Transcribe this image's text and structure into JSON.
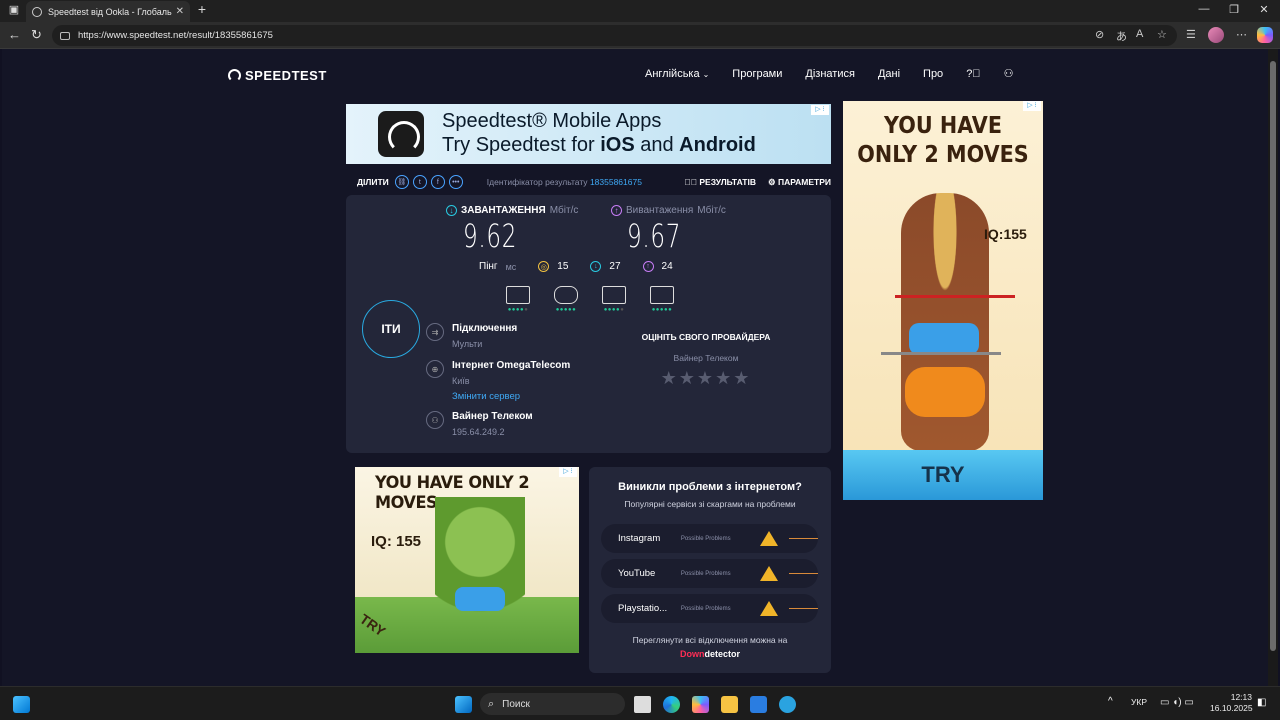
{
  "browser": {
    "tab_title": "Speedtest від Ookla - Глобальний тест швидкості",
    "url": "https://www.speedtest.net/result/18355861675"
  },
  "site": {
    "logo": "SPEEDTEST",
    "nav": [
      "Англійська",
      "Програми",
      "Дізнатися",
      "Дані",
      "Про"
    ]
  },
  "ad_top": {
    "line1": "Speedtest® Mobile Apps",
    "line2_pre": "Try Speedtest for ",
    "line2_ios": "iOS",
    "line2_mid": " and ",
    "line2_android": "Android"
  },
  "share": {
    "label": "ДІЛИТИ",
    "result_id_label": "Ідентифікатор результату",
    "result_id": "18355861675",
    "results_btn": "РЕЗУЛЬТАТІВ",
    "settings_btn": "ПАРАМЕТРИ"
  },
  "result": {
    "download_label": "ЗАВАНТАЖЕННЯ",
    "download_unit": "Мбіт/с",
    "download_value": "9.62",
    "upload_label": "Вивантаження",
    "upload_unit": "Мбіт/с",
    "upload_value": "9.67",
    "ping_label": "Пінг",
    "ping_unit": "мс",
    "ping_idle": "15",
    "ping_down": "27",
    "ping_up": "24",
    "go_label": "ІТИ",
    "connection_title": "Підключення",
    "connection_value": "Мульти",
    "server_title": "Інтернет OmegaTelecom",
    "server_city": "Київ",
    "change_server": "Змінити сервер",
    "provider_title": "Вайнер Телеком",
    "provider_ip": "195.64.249.2",
    "rate_title": "ОЦІНІТЬ СВОГО ПРОВАЙДЕРА",
    "rate_provider": "Вайнер Телеком",
    "stars": "★★★★★"
  },
  "ad_game_small": {
    "headline": "YOU HAVE ONLY 2 MOVES",
    "iq": "IQ: 155",
    "cta": "TRY"
  },
  "problems": {
    "title": "Виникли проблеми з інтернетом?",
    "subtitle": "Популярні сервіси зі скаргами на проблеми",
    "rows": [
      {
        "name": "Instagram",
        "status": "Possible Problems"
      },
      {
        "name": "YouTube",
        "status": "Possible Problems"
      },
      {
        "name": "Playstatio...",
        "status": "Possible Problems"
      }
    ],
    "footer": "Переглянути всі відключення можна на",
    "brand_down": "Down",
    "brand_detector": "detector"
  },
  "ad_game_large": {
    "headline1": "YOU HAVE",
    "headline2": "ONLY 2 MOVES",
    "iq": "IQ:155",
    "cta": "TRY"
  },
  "taskbar": {
    "search_placeholder": "Поиск",
    "lang": "УКР",
    "time": "12:13",
    "date": "16.10.2025"
  }
}
